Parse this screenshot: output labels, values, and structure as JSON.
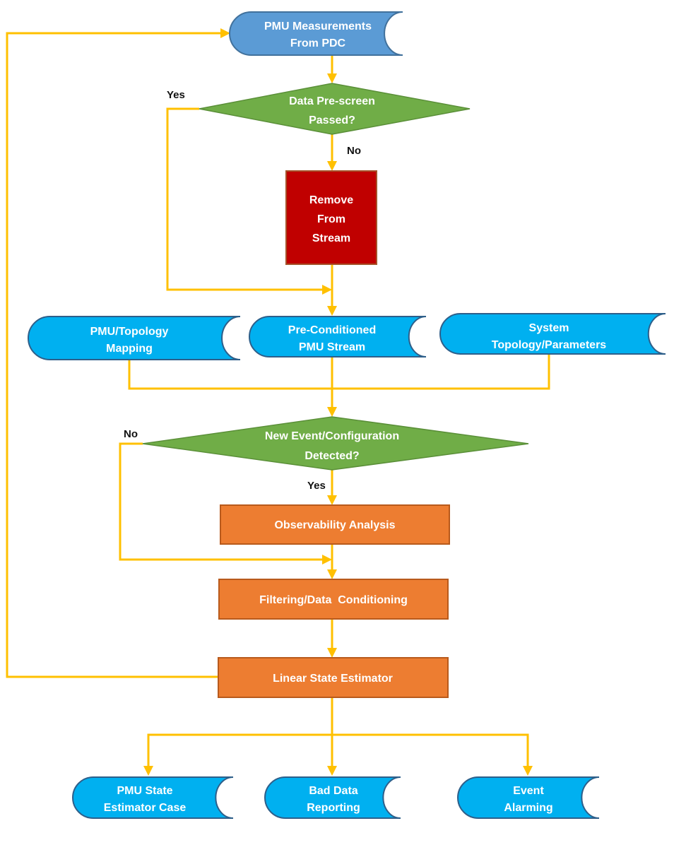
{
  "colors": {
    "data_input": "#5b9bd5",
    "stored_data": "#00b0f0",
    "decision": "#70ad47",
    "remove": "#c00000",
    "process": "#ed7d31",
    "connector": "#ffc000"
  },
  "nodes": {
    "pmu_measurements": [
      "PMU Measurements",
      "From PDC"
    ],
    "prescreen": [
      "Data Pre-screen",
      "Passed?"
    ],
    "remove": [
      "Remove",
      "From",
      "Stream"
    ],
    "topology_mapping": [
      "PMU/Topology",
      "Mapping"
    ],
    "preconditioned": [
      "Pre-Conditioned",
      "PMU Stream"
    ],
    "system_topology": [
      "System",
      "Topology/Parameters"
    ],
    "event_detect": [
      "New Event/Configuration",
      "Detected?"
    ],
    "observability": "Observability Analysis",
    "filtering": "Filtering/Data  Conditioning",
    "lse": "Linear State Estimator",
    "se_case": [
      "PMU State",
      "Estimator Case"
    ],
    "bad_data": [
      "Bad Data",
      "Reporting"
    ],
    "alarming": [
      "Event",
      "Alarming"
    ]
  },
  "labels": {
    "prescreen_yes": "Yes",
    "prescreen_no": "No",
    "event_no": "No",
    "event_yes": "Yes"
  }
}
